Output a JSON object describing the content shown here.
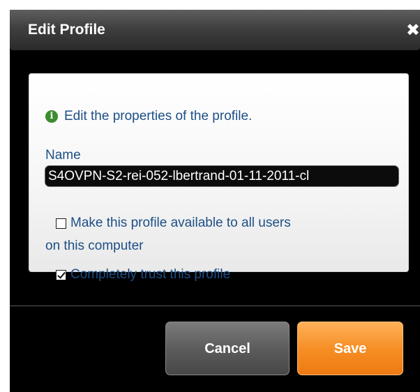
{
  "dialog": {
    "title": "Edit Profile",
    "close_symbol": "✖",
    "info_icon": "info-icon",
    "info_text": "Edit the properties of the profile.",
    "name_label": "Name",
    "name_value": "S4OVPN-S2-rei-052-lbertrand-01-11-2011-cl",
    "options": [
      {
        "label": "Make this profile available to all users",
        "label_cont": "on this computer",
        "checked": false
      },
      {
        "label": "Completely trust this profile",
        "checked": true
      }
    ],
    "buttons": {
      "cancel": "Cancel",
      "save": "Save"
    }
  },
  "colors": {
    "accent": "#f68f26",
    "text": "#1d4f86",
    "info": "#3c8d2e"
  }
}
